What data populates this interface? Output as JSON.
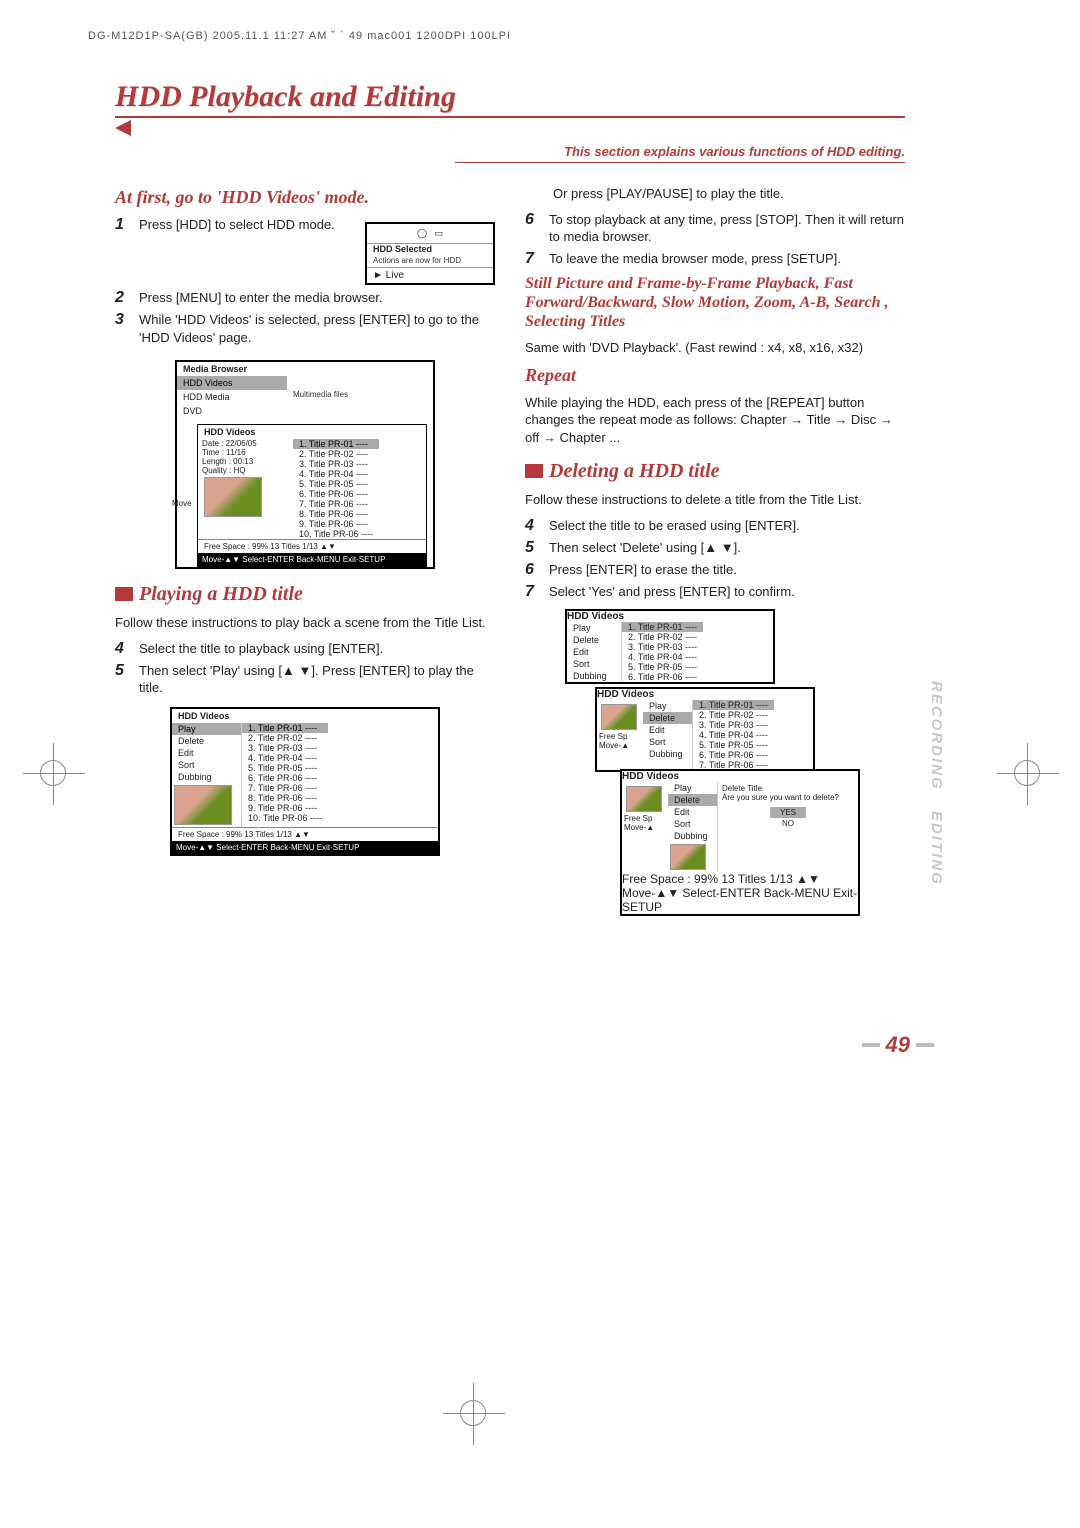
{
  "header_strip": "DG-M12D1P-SA(GB)  2005.11.1 11:27 AM  ˘ ` 49   mac001  1200DPI 100LPI",
  "page_title": "HDD Playback and Editing",
  "explain": "This section explains various functions of HDD editing.",
  "side_labels": {
    "a": "RECORDING",
    "b": "EDITING"
  },
  "page_number": "49",
  "left": {
    "sub1": "At first, go to 'HDD Videos' mode.",
    "s1": "Press [HDD] to select HDD mode.",
    "hdd_box": {
      "title": "HDD Selected",
      "line1": "Actions are now for HDD",
      "live": "► Live"
    },
    "s2": "Press [MENU] to enter the media browser.",
    "s3": "While 'HDD Videos' is selected, press [ENTER] to go to the 'HDD Videos' page.",
    "media_browser": {
      "title": "Media Browser",
      "items": [
        "HDD Videos",
        "HDD Media",
        "DVD"
      ],
      "right_note": "Multimedia files"
    },
    "hdd_videos_panel": {
      "title": "HDD Videos",
      "meta": [
        "Date : 22/06/05",
        "Time : 11/16",
        "Length : 00:13",
        "Quality : HQ"
      ],
      "move_label": "Move",
      "titles": [
        "1. Title PR-01 ----",
        "2. Title PR-02 ----",
        "3. Title PR-03 ----",
        "4. Title PR-04 ----",
        "5. Title PR-05 ----",
        "6. Title PR-06 ----",
        "7. Title PR-06 ----",
        "8. Title PR-06 ----",
        "9. Title PR-06 ----",
        "10. Title PR-06 ----"
      ],
      "status": "Free Space : 99% 13 Titles       1/13  ▲▼",
      "foot": "Move-▲▼  Select-ENTER  Back-MENU  Exit-SETUP"
    },
    "section_play": "Playing a HDD title",
    "play_intro": "Follow these instructions to play back a scene from the Title List.",
    "s4": "Select the title to playback using [ENTER].",
    "s5": "Then select 'Play' using [▲ ▼]. Press [ENTER] to play the title.",
    "play_panel": {
      "title": "HDD Videos",
      "menu": [
        "Play",
        "Delete",
        "Edit",
        "Sort",
        "Dubbing"
      ],
      "titles": [
        "1. Title PR-01 ----",
        "2. Title PR-02 ----",
        "3. Title PR-03 ----",
        "4. Title PR-04 ----",
        "5. Title PR-05 ----",
        "6. Title PR-06 ----",
        "7. Title PR-06 ----",
        "8. Title PR-06 ----",
        "9. Title PR-06 ----",
        "10. Title PR-06 ----"
      ],
      "status": "Free Space : 99% 13 Titles       1/13  ▲▼",
      "foot": "Move-▲▼  Select-ENTER  Back-MENU  Exit-SETUP"
    }
  },
  "right": {
    "r_or": "Or press [PLAY/PAUSE] to play the title.",
    "s6": "To stop playback at any time, press [STOP]. Then it will return to media browser.",
    "s7": "To leave the media browser mode, press [SETUP].",
    "still_head": "Still Picture and Frame-by-Frame Playback, Fast Forward/Backward, Slow Motion, Zoom, A-B, Search , Selecting Titles",
    "still_body": "Same with 'DVD Playback'. (Fast rewind : x4, x8, x16, x32)",
    "repeat_head": "Repeat",
    "repeat_body": "While playing the HDD, each press of the [REPEAT] button changes the repeat mode as follows: Chapter → Title → Disc → off → Chapter ...",
    "section_delete": "Deleting a HDD title",
    "del_intro": "Follow these instructions to delete a title from the Title List.",
    "ds4": "Select the title to be erased using [ENTER].",
    "ds5": "Then select 'Delete' using [▲ ▼].",
    "ds6": "Press [ENTER] to erase the title.",
    "ds7": "Select 'Yes'  and press [ENTER] to confirm.",
    "cascade": {
      "lvl1": {
        "title": "HDD Videos",
        "menu": [
          "Play",
          "Delete",
          "Edit",
          "Sort",
          "Dubbing"
        ],
        "titles": [
          "1. Title PR-01 ----",
          "2. Title PR-02 ----",
          "3. Title PR-03 ----",
          "4. Title PR-04 ----",
          "5. Title PR-05 ----",
          "6. Title PR-06 ----"
        ]
      },
      "lvl2": {
        "title": "HDD Videos",
        "free": "Free Sp",
        "move": "Move-▲",
        "menu": [
          "Play",
          "Delete",
          "Edit",
          "Sort",
          "Dubbing"
        ],
        "titles": [
          "1. Title PR-01 ----",
          "2. Title PR-02 ----",
          "3. Title PR-03 ----",
          "4. Title PR-04 ----",
          "5. Title PR-05 ----",
          "6. Title PR-06 ----",
          "7. Title PR-06 ----"
        ]
      },
      "lvl3": {
        "title": "HDD Videos",
        "free": "Free Sp",
        "move": "Move-▲",
        "menu": [
          "Play",
          "Delete",
          "Edit",
          "Sort",
          "Dubbing"
        ],
        "dialog_title": "Delete Title",
        "dialog_q": "Are you sure you want to delete?",
        "yes": "YES",
        "no": "NO",
        "status": "Free Space : 99% 13 Titles       1/13  ▲▼",
        "foot": "Move-▲▼  Select-ENTER  Back-MENU  Exit-SETUP"
      }
    }
  }
}
